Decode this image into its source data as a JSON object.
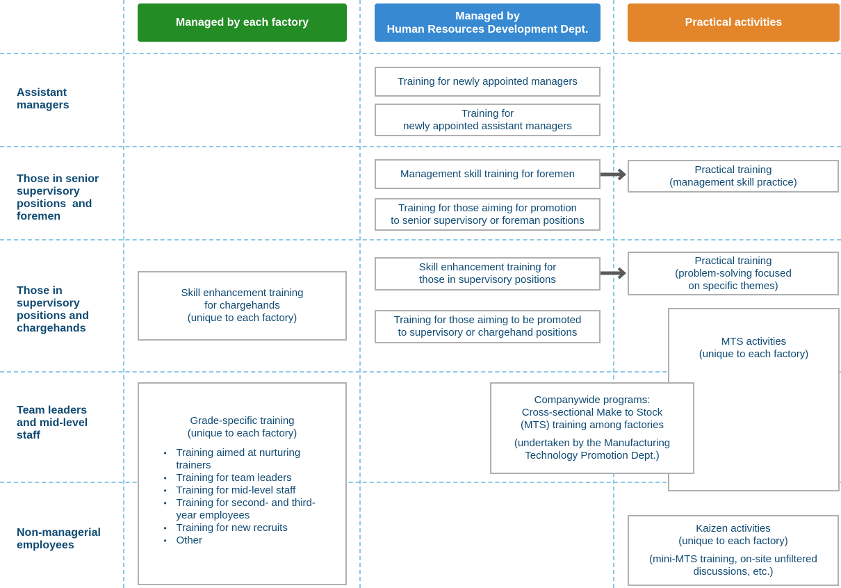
{
  "colors": {
    "factory_header": "#238c24",
    "hrd_header": "#3789d2",
    "practical_header": "#e3852a",
    "text": "#0f4a72",
    "grid_line": "#8cc8e6",
    "box_border": "#b0b0b0",
    "arrow": "#5a5a5a"
  },
  "headers": {
    "factory": "Managed by each factory",
    "hrd_line1": "Managed by",
    "hrd_line2": "Human Resources Development Dept.",
    "practical": "Practical activities"
  },
  "rows": [
    {
      "id": "assistant-managers",
      "lines": [
        "Assistant",
        "managers"
      ]
    },
    {
      "id": "senior-supervisory",
      "lines": [
        "Those in senior",
        "supervisory",
        "positions  and",
        "foremen"
      ]
    },
    {
      "id": "supervisory",
      "lines": [
        "Those in",
        "supervisory",
        "positions and",
        "chargehands"
      ]
    },
    {
      "id": "team-leaders",
      "lines": [
        "Team leaders",
        "and mid-level",
        "staff"
      ]
    },
    {
      "id": "non-managerial",
      "lines": [
        "Non-managerial",
        "employees"
      ]
    }
  ],
  "hrd_boxes": {
    "new_managers": [
      "Training for newly appointed managers"
    ],
    "new_assistant_managers": [
      "Training for",
      "newly appointed assistant managers"
    ],
    "foremen_mgmt": [
      "Management skill training for foremen"
    ],
    "aiming_senior": [
      "Training for those aiming for promotion",
      "to senior supervisory or foreman positions"
    ],
    "supervisory_skill": [
      "Skill enhancement training for",
      "those in supervisory positions"
    ],
    "aiming_supervisory": [
      "Training for those aiming to be promoted",
      "to supervisory or chargehand positions"
    ]
  },
  "factory_boxes": {
    "chargehands": [
      "Skill enhancement training",
      "for chargehands",
      "(unique to each factory)"
    ],
    "grade_specific": {
      "title": [
        "Grade-specific training",
        "(unique to each factory)"
      ],
      "items": [
        "Training aimed at nurturing trainers",
        "Training for team leaders",
        "Training for mid-level staff",
        "Training for second- and third-year employees",
        "Training for new recruits",
        "Other"
      ]
    }
  },
  "practical_boxes": {
    "mgmt_practice": [
      "Practical training",
      "(management skill practice)"
    ],
    "problem_solving": [
      "Practical training",
      "(problem-solving focused",
      "on specific themes)"
    ],
    "mts": [
      "MTS activities",
      "(unique to each factory)"
    ],
    "kaizen": {
      "title": [
        "Kaizen activities",
        "(unique to each factory)"
      ],
      "note": [
        "(mini-MTS training, on-site unfiltered",
        "discussions, etc.)"
      ]
    }
  },
  "companywide": {
    "title": [
      "Companywide programs:",
      "Cross-sectional Make to Stock",
      "(MTS) training among factories"
    ],
    "note": [
      "(undertaken by the Manufacturing",
      "Technology Promotion Dept.)"
    ]
  }
}
